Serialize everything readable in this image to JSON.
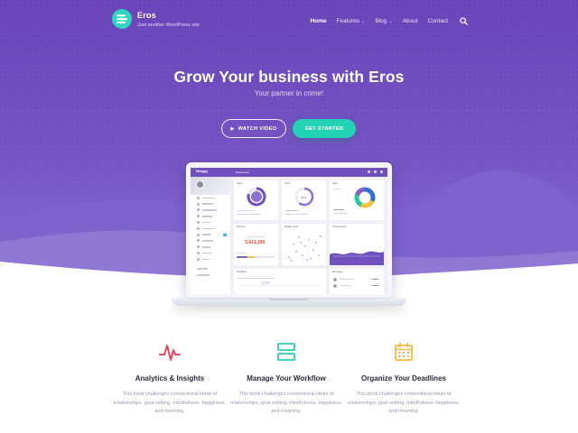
{
  "site": {
    "name": "Eros",
    "tagline": "Just another WordPress site"
  },
  "nav": {
    "items": [
      {
        "label": "Home",
        "active": true,
        "dropdown": false
      },
      {
        "label": "Features",
        "active": false,
        "dropdown": true
      },
      {
        "label": "Blog",
        "active": false,
        "dropdown": true
      },
      {
        "label": "About",
        "active": false,
        "dropdown": false
      },
      {
        "label": "Contact",
        "active": false,
        "dropdown": false
      }
    ],
    "search_icon": "search-icon",
    "caret_glyph": "⌄"
  },
  "hero": {
    "title": "Grow Your business with Eros",
    "subtitle": "Your partner in crime!",
    "watch_label": "WATCH VIDEO",
    "start_label": "GET STARTED"
  },
  "dashboard": {
    "brand": "Wrappy",
    "page": "Dashboard",
    "cards": {
      "sales": "Sales",
      "visits": "Visits",
      "sells": "Sells",
      "returns": "Returns",
      "weekly": "Weekly visits",
      "total": "Total revenue",
      "total_value": "3,421,100",
      "visits_pct": "60%",
      "messages": "Messages",
      "timeline": "Workflow"
    },
    "sidebar_badge": "10"
  },
  "features": [
    {
      "icon": "pulse-chart-icon",
      "title": "Analytics & Insights",
      "desc": "This book challenges conventional ideas of relationships, goal-setting, mindfulness, happiness, and meaning.",
      "color": "#e8475f"
    },
    {
      "icon": "workflow-boxes-icon",
      "title": "Manage Your Workflow",
      "desc": "This book challenges conventional ideas of relationships, goal-setting, mindfulness, happiness, and meaning.",
      "color": "#2fcdb1"
    },
    {
      "icon": "calendar-icon",
      "title": "Organize Your Deadlines",
      "desc": "This book challenges conventional ideas of relationships, goal-setting, mindfulness, happiness, and meaning.",
      "color": "#f5b941"
    }
  ],
  "colors": {
    "hero": "#6a44b9",
    "accent": "#23d3b3",
    "text_dark": "#2a2a3a",
    "text_muted": "#9a9ab0"
  }
}
